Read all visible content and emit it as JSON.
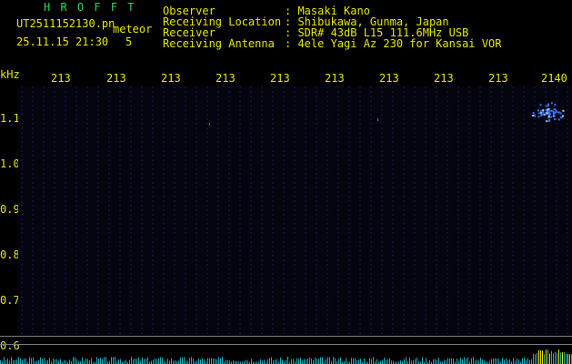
{
  "header": {
    "app_name": "H R O F F T",
    "filename": "UT2511152130.pn",
    "tag": "meteor",
    "datetime": "25.11.15 21:30",
    "count": "5"
  },
  "info": {
    "labels": [
      "Observer",
      "Receiving Location",
      "Receiver",
      "Receiving Antenna"
    ],
    "values": [
      ": Masaki Kano",
      ": Shibukawa, Gunma, Japan",
      ": SDR# 43dB L15 111.6MHz USB",
      ": 4ele Yagi Az 230 for Kansai VOR"
    ]
  },
  "axis": {
    "y_unit": "kHz",
    "y_ticks": [
      "1.1",
      "1.0",
      "0.9",
      "0.8",
      "0.7",
      "0.6"
    ],
    "x_ticks": [
      "213",
      "213",
      "213",
      "213",
      "213",
      "213",
      "213",
      "213",
      "213",
      "2140"
    ]
  },
  "colors": {
    "background": "#000000",
    "text_green": "#2fd35a",
    "text_yellow": "#e6e600",
    "grid": "#1a1a5a",
    "echo": "#3a70ff"
  }
}
